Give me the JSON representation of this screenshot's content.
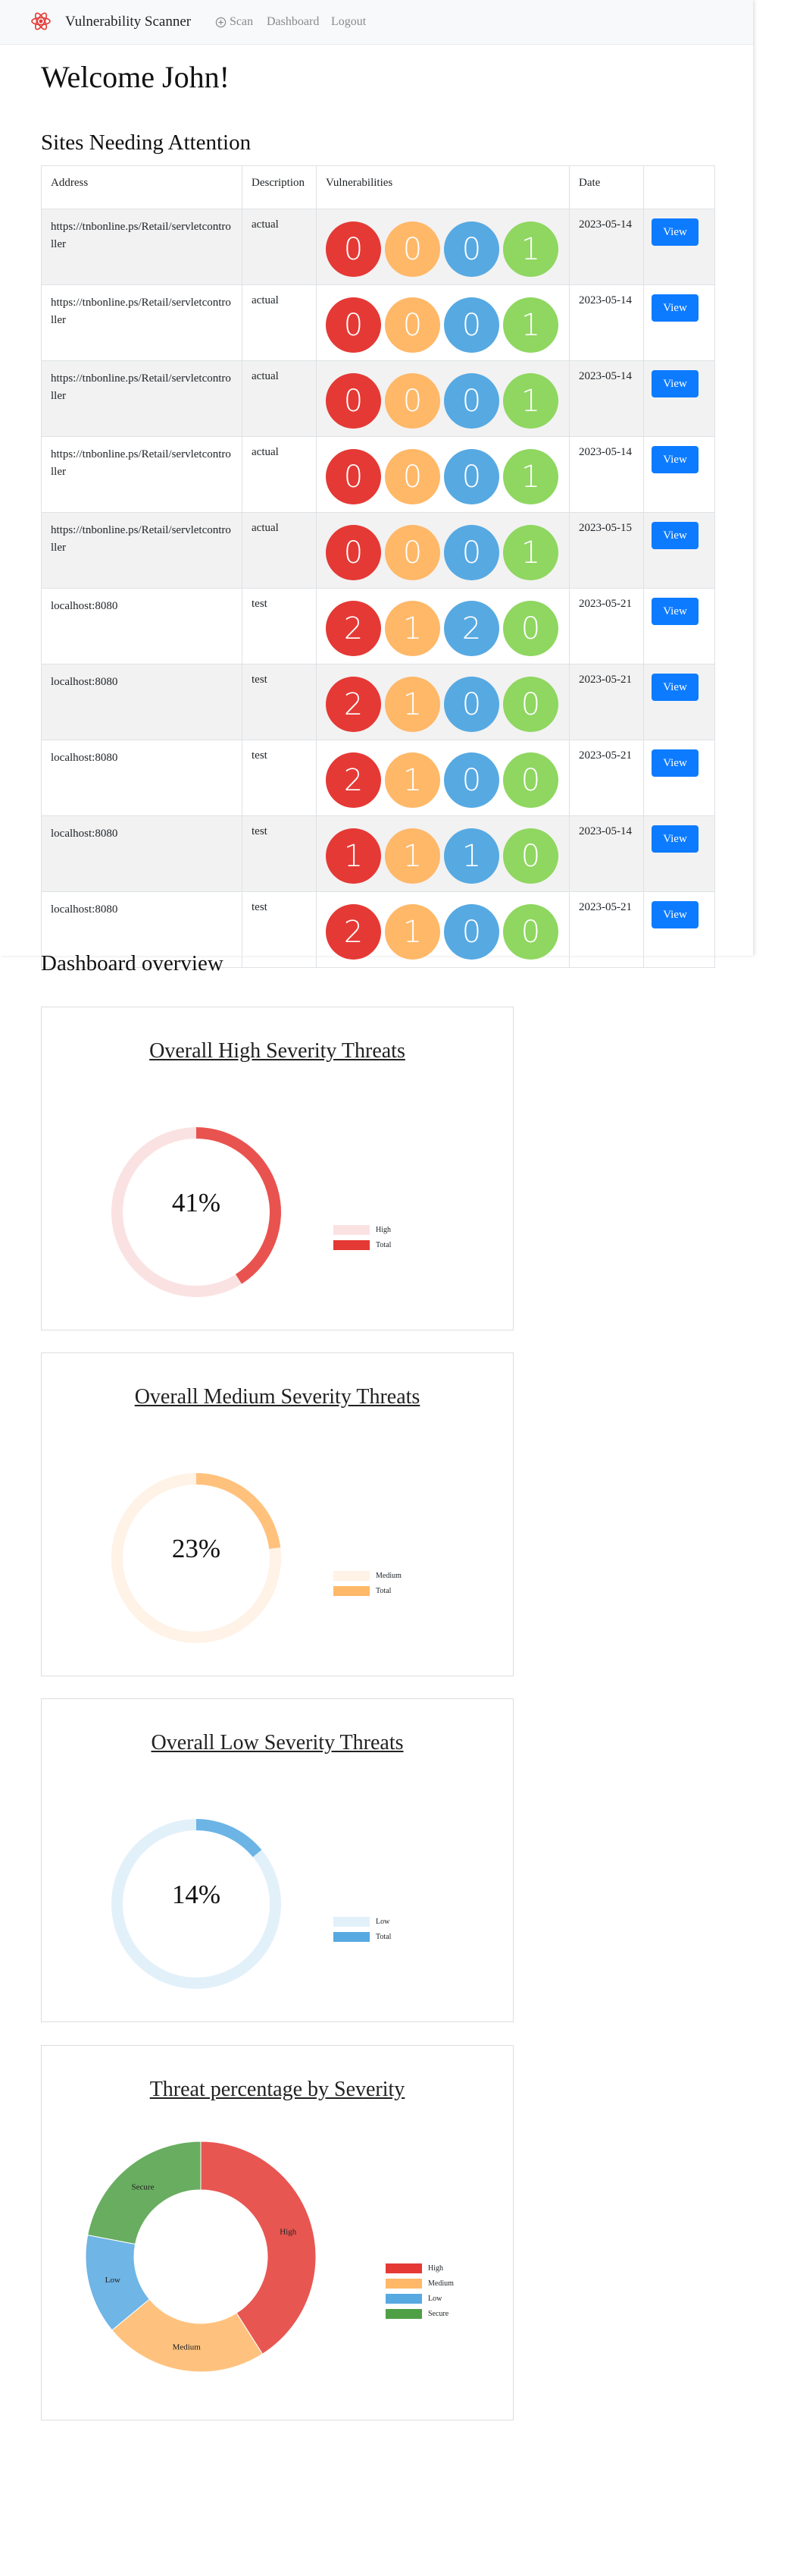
{
  "nav": {
    "brand": "Vulnerability Scanner",
    "scan": "Scan",
    "dashboard": "Dashboard",
    "logout": "Logout"
  },
  "welcome": "Welcome John!",
  "sites_section": {
    "title": "Sites Needing Attention",
    "headers": [
      "Address",
      "Description",
      "Vulnerabilities",
      "Date",
      ""
    ],
    "view_label": "View",
    "rows": [
      {
        "address": "https://tnbonline.ps/Retail/servletcontroller",
        "description": "actual",
        "high": 0,
        "medium": 0,
        "low": 0,
        "secure": 1,
        "date": "2023-05-14"
      },
      {
        "address": "https://tnbonline.ps/Retail/servletcontroller",
        "description": "actual",
        "high": 0,
        "medium": 0,
        "low": 0,
        "secure": 1,
        "date": "2023-05-14"
      },
      {
        "address": "https://tnbonline.ps/Retail/servletcontroller",
        "description": "actual",
        "high": 0,
        "medium": 0,
        "low": 0,
        "secure": 1,
        "date": "2023-05-14"
      },
      {
        "address": "https://tnbonline.ps/Retail/servletcontroller",
        "description": "actual",
        "high": 0,
        "medium": 0,
        "low": 0,
        "secure": 1,
        "date": "2023-05-14"
      },
      {
        "address": "https://tnbonline.ps/Retail/servletcontroller",
        "description": "actual",
        "high": 0,
        "medium": 0,
        "low": 0,
        "secure": 1,
        "date": "2023-05-15"
      },
      {
        "address": "localhost:8080",
        "description": "test",
        "high": 2,
        "medium": 1,
        "low": 2,
        "secure": 0,
        "date": "2023-05-21"
      },
      {
        "address": "localhost:8080",
        "description": "test",
        "high": 2,
        "medium": 1,
        "low": 0,
        "secure": 0,
        "date": "2023-05-21"
      },
      {
        "address": "localhost:8080",
        "description": "test",
        "high": 2,
        "medium": 1,
        "low": 0,
        "secure": 0,
        "date": "2023-05-21"
      },
      {
        "address": "localhost:8080",
        "description": "test",
        "high": 1,
        "medium": 1,
        "low": 1,
        "secure": 0,
        "date": "2023-05-14"
      },
      {
        "address": "localhost:8080",
        "description": "test",
        "high": 2,
        "medium": 1,
        "low": 0,
        "secure": 0,
        "date": "2023-05-21"
      }
    ]
  },
  "dashboard": {
    "title": "Dashboard overview"
  },
  "colors": {
    "high": "#e53935",
    "medium": "#ffb868",
    "low": "#57a9e2",
    "secure": "#8fd760",
    "button": "#0d7bff"
  },
  "chart_data": [
    {
      "type": "pie",
      "title": "Overall High Severity Threats",
      "center_label": "41%",
      "labels": [
        "High",
        "Total"
      ],
      "values": [
        41,
        59
      ],
      "colors": [
        "#e53935",
        "#fbe2e2"
      ]
    },
    {
      "type": "pie",
      "title": "Overall Medium Severity Threats",
      "center_label": "23%",
      "labels": [
        "Medium",
        "Total"
      ],
      "values": [
        23,
        77
      ],
      "colors": [
        "#ffb868",
        "#fff2e6"
      ]
    },
    {
      "type": "pie",
      "title": "Overall Low Severity Threats",
      "center_label": "14%",
      "labels": [
        "Low",
        "Total"
      ],
      "values": [
        14,
        86
      ],
      "colors": [
        "#57a9e2",
        "#e2f0fa"
      ]
    },
    {
      "type": "pie",
      "title": "Threat percentage by Severity",
      "labels": [
        "High",
        "Medium",
        "Low",
        "Secure"
      ],
      "values": [
        41,
        23,
        14,
        22
      ],
      "colors": [
        "#e53935",
        "#ffb868",
        "#57a9e2",
        "#4e9f45"
      ]
    }
  ]
}
